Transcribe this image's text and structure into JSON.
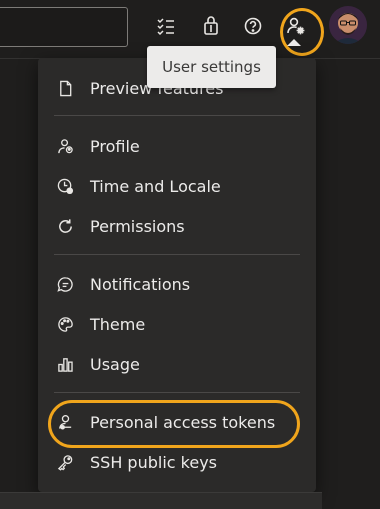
{
  "header": {
    "search": {
      "value": ""
    },
    "icons": [
      "task-list-icon",
      "shopping-bag-icon",
      "help-icon",
      "user-settings-icon"
    ],
    "avatar": "avatar"
  },
  "tooltip": {
    "text": "User settings"
  },
  "menu": {
    "groups": [
      [
        {
          "label": "Preview features",
          "icon": "document-icon"
        }
      ],
      [
        {
          "label": "Profile",
          "icon": "profile-icon"
        },
        {
          "label": "Time and Locale",
          "icon": "time-locale-icon"
        },
        {
          "label": "Permissions",
          "icon": "refresh-icon"
        }
      ],
      [
        {
          "label": "Notifications",
          "icon": "chat-bubble-icon"
        },
        {
          "label": "Theme",
          "icon": "palette-icon"
        },
        {
          "label": "Usage",
          "icon": "bar-chart-icon"
        }
      ],
      [
        {
          "label": "Personal access tokens",
          "icon": "person-key-icon"
        },
        {
          "label": "SSH public keys",
          "icon": "key-icon"
        }
      ]
    ]
  },
  "colors": {
    "highlight": "#f0a51c",
    "menu_bg": "#2b2a29",
    "page_bg": "#1f1e1d"
  }
}
